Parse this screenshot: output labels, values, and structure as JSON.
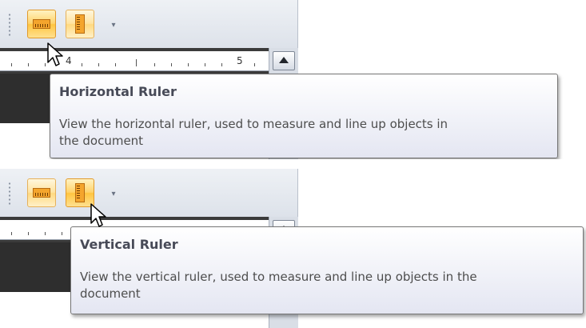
{
  "panels": [
    {
      "ruler_labels": [
        "4",
        "5"
      ],
      "tooltip": {
        "title": "Horizontal Ruler",
        "body_line1": "View the horizontal ruler, used to measure and line up objects in",
        "body_line2": "the document"
      },
      "buttons": {
        "horizontal_ruler_icon": "horizontal-ruler-icon",
        "vertical_ruler_icon": "vertical-ruler-icon"
      }
    },
    {
      "tooltip": {
        "title": "Vertical Ruler",
        "body_line1": "View the vertical ruler, used to measure and line up objects in the",
        "body_line2": "document"
      },
      "buttons": {
        "horizontal_ruler_icon": "horizontal-ruler-icon",
        "vertical_ruler_icon": "vertical-ruler-icon"
      }
    }
  ],
  "colors": {
    "button_highlight": "#ffd36b",
    "button_border": "#e29a2a",
    "tooltip_bg_top": "#ffffff",
    "tooltip_bg_bottom": "#e4e6f2",
    "ruler_dark": "#3b3b3b"
  }
}
